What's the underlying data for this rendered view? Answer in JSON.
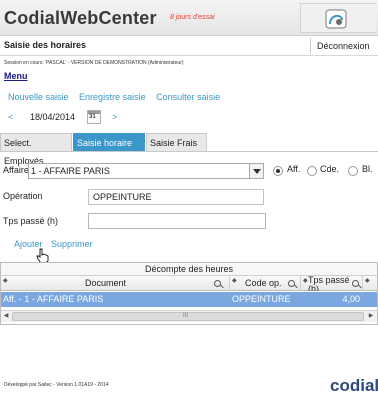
{
  "header": {
    "app_title": "CodialWebCenter",
    "trial_label": "8 jours d'essai",
    "logo_icon": "codial-icon"
  },
  "subheader": {
    "page_title": "Saisie des horaires",
    "logout_label": "Déconnexion"
  },
  "session_info": "Session en cours: 'PASCAL' - VERSION DE DEMONSTRATION (Administrateur)",
  "menu_label": "Menu",
  "toplinks": {
    "new_entry": "Nouvelle saisie",
    "save_entry": "Enregistre saisie",
    "view_entry": "Consulter saisie"
  },
  "datebar": {
    "prev": "<",
    "date": "18/04/2014",
    "calendar_day": "31",
    "next": ">"
  },
  "tabs": [
    {
      "label": "Select. Employés",
      "active": false
    },
    {
      "label": "Saisie horaire",
      "active": true
    },
    {
      "label": "Saisie Frais",
      "active": false
    }
  ],
  "form": {
    "affaire_label": "Affaire",
    "affaire_value": "1 - AFFAIRE PARIS",
    "radio_aff": "Aff.",
    "radio_cde": "Cde.",
    "radio_bl": "Bl.",
    "operation_label": "Opération",
    "operation_value": "OPPEINTURE",
    "time_label": "Tps passé (h)",
    "time_value": ""
  },
  "actions": {
    "add": "Ajouter",
    "delete": "Supprimer"
  },
  "grid": {
    "caption": "Décompte des heures",
    "columns": [
      "Document",
      "Code op.",
      "Tps passé (h)"
    ],
    "rows": [
      {
        "document": "Aff. - 1 - AFFAIRE PARIS",
        "code_op": "OPPEINTURE",
        "time": "4,00"
      }
    ],
    "scroll_grip": "III"
  },
  "footer": {
    "text": "Développé par Saitec - Version 1.01A19 - 2014",
    "logo": "codial"
  },
  "colors": {
    "accent": "#3b97c9",
    "selected_row": "#7aa7e0",
    "trial": "#e63a2e"
  }
}
